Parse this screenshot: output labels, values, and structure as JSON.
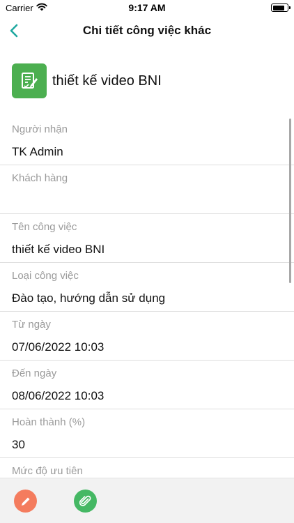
{
  "status_bar": {
    "carrier": "Carrier",
    "time": "9:17 AM",
    "battery_level": 0.85
  },
  "nav": {
    "title": "Chi tiết công việc khác",
    "back_icon": "chevron-left-icon",
    "accent_color": "#1fa8a0"
  },
  "header": {
    "icon": "task-document-icon",
    "icon_color": "#4caf50",
    "title": "thiết kế video BNI"
  },
  "fields": [
    {
      "label": "Người nhận",
      "value": "TK Admin"
    },
    {
      "label": "Khách hàng",
      "value": ""
    },
    {
      "label": "Tên công việc",
      "value": "thiết kế video BNI"
    },
    {
      "label": "Loại công việc",
      "value": "Đào tạo, hướng dẫn sử dụng"
    },
    {
      "label": "Từ ngày",
      "value": "07/06/2022 10:03"
    },
    {
      "label": "Đến ngày",
      "value": "08/06/2022 10:03"
    },
    {
      "label": "Hoàn thành (%)",
      "value": "30"
    },
    {
      "label": "Mức độ ưu tiên",
      "value": ""
    }
  ],
  "bottom_bar": {
    "edit_icon": "pencil-icon",
    "edit_color": "#f47c5e",
    "attach_icon": "paperclip-icon",
    "attach_color": "#45b864"
  }
}
